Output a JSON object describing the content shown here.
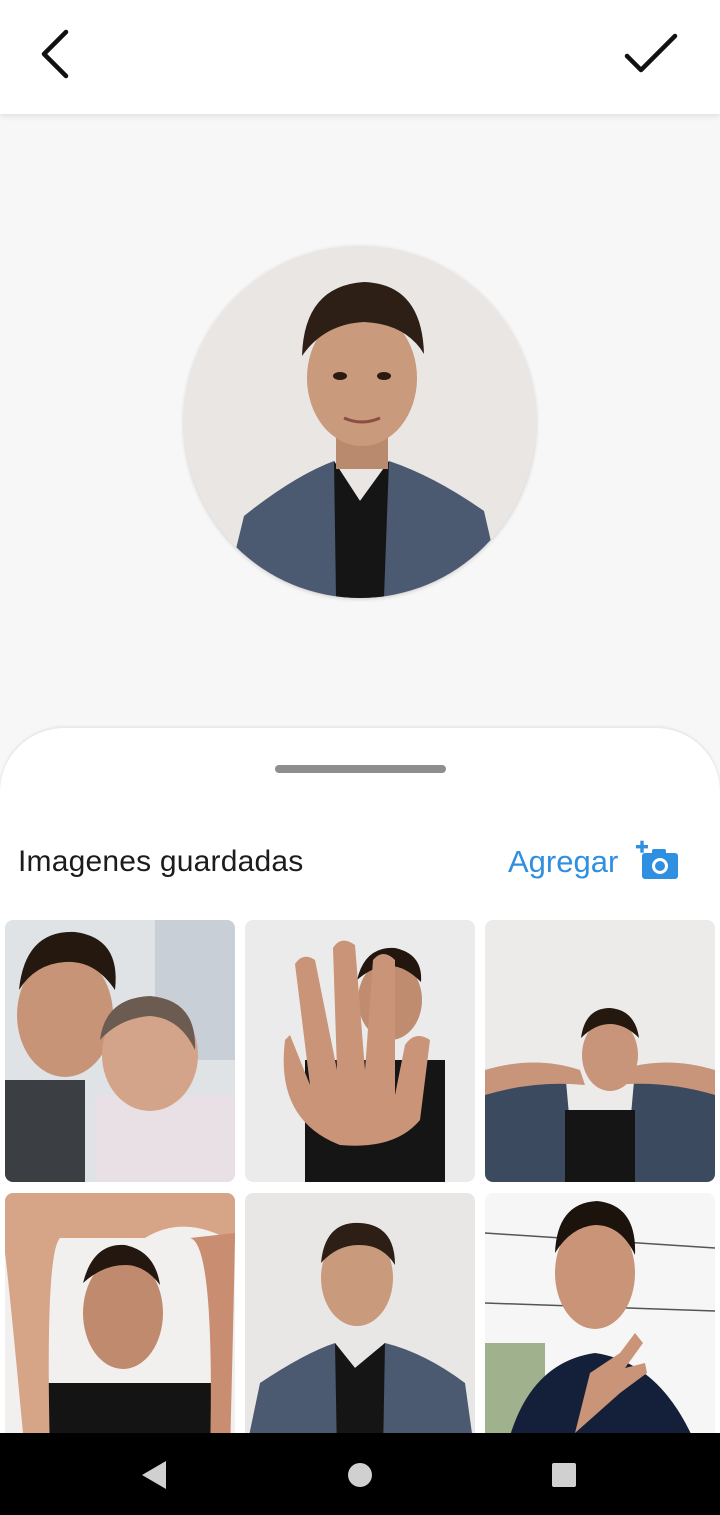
{
  "header": {
    "back_icon": "chevron-left-icon",
    "confirm_icon": "checkmark-icon"
  },
  "preview": {
    "image": "profile-photo-preview"
  },
  "sheet": {
    "title": "Imagenes guardadas",
    "add_label": "Agregar",
    "add_icon": "add-photo-camera-icon",
    "accent_color": "#2f8fe0"
  },
  "gallery": {
    "images": [
      "saved-photo-selfie-with-grandmother",
      "saved-photo-hand-in-front",
      "saved-photo-hands-behind-head",
      "saved-photo-finger-frame",
      "saved-photo-denim-shirt",
      "saved-photo-peace-sign"
    ]
  },
  "navbar": {
    "back_icon": "nav-back-triangle-icon",
    "home_icon": "nav-home-circle-icon",
    "recents_icon": "nav-recents-square-icon"
  }
}
